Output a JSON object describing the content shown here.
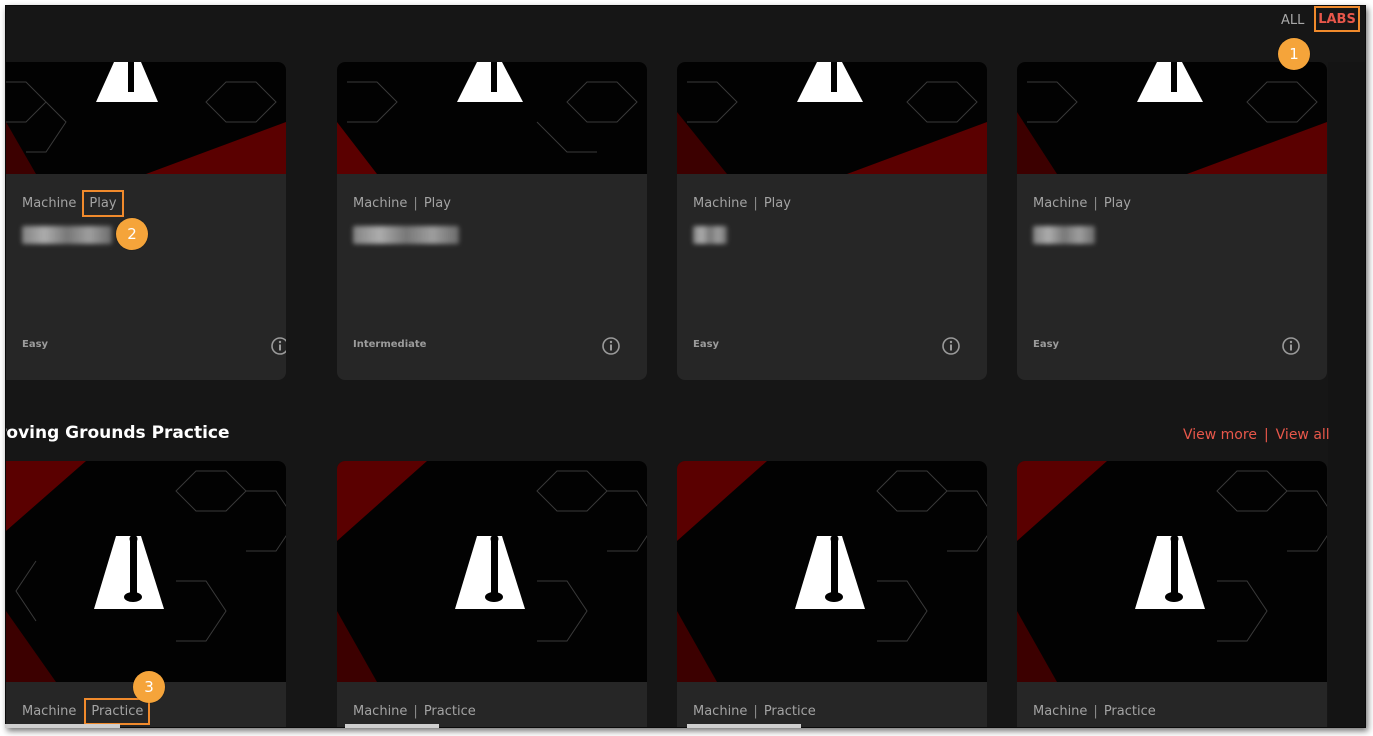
{
  "nav": {
    "all_label": "ALL",
    "labs_label": "LABS"
  },
  "callouts": [
    "1",
    "2",
    "3"
  ],
  "colors": {
    "accent": "#e8574a",
    "highlight": "#f08a2c",
    "callout": "#f5a43a",
    "card": "#262626",
    "background": "#161616"
  },
  "row1": {
    "cards": [
      {
        "category": "Machine",
        "type": "Play",
        "level": "Easy"
      },
      {
        "category": "Machine",
        "type": "Play",
        "level": "Intermediate"
      },
      {
        "category": "Machine",
        "type": "Play",
        "level": "Easy"
      },
      {
        "category": "Machine",
        "type": "Play",
        "level": "Easy"
      }
    ]
  },
  "section": {
    "title": "roving Grounds Practice",
    "view_more": "View more",
    "view_all": "View all",
    "separator": "|"
  },
  "row2": {
    "cards": [
      {
        "category": "Machine",
        "type": "Practice"
      },
      {
        "category": "Machine",
        "type": "Practice"
      },
      {
        "category": "Machine",
        "type": "Practice"
      },
      {
        "category": "Machine",
        "type": "Practice"
      }
    ]
  },
  "icons": {
    "info": "info-icon",
    "lab_logo": "flask-figure-icon"
  }
}
